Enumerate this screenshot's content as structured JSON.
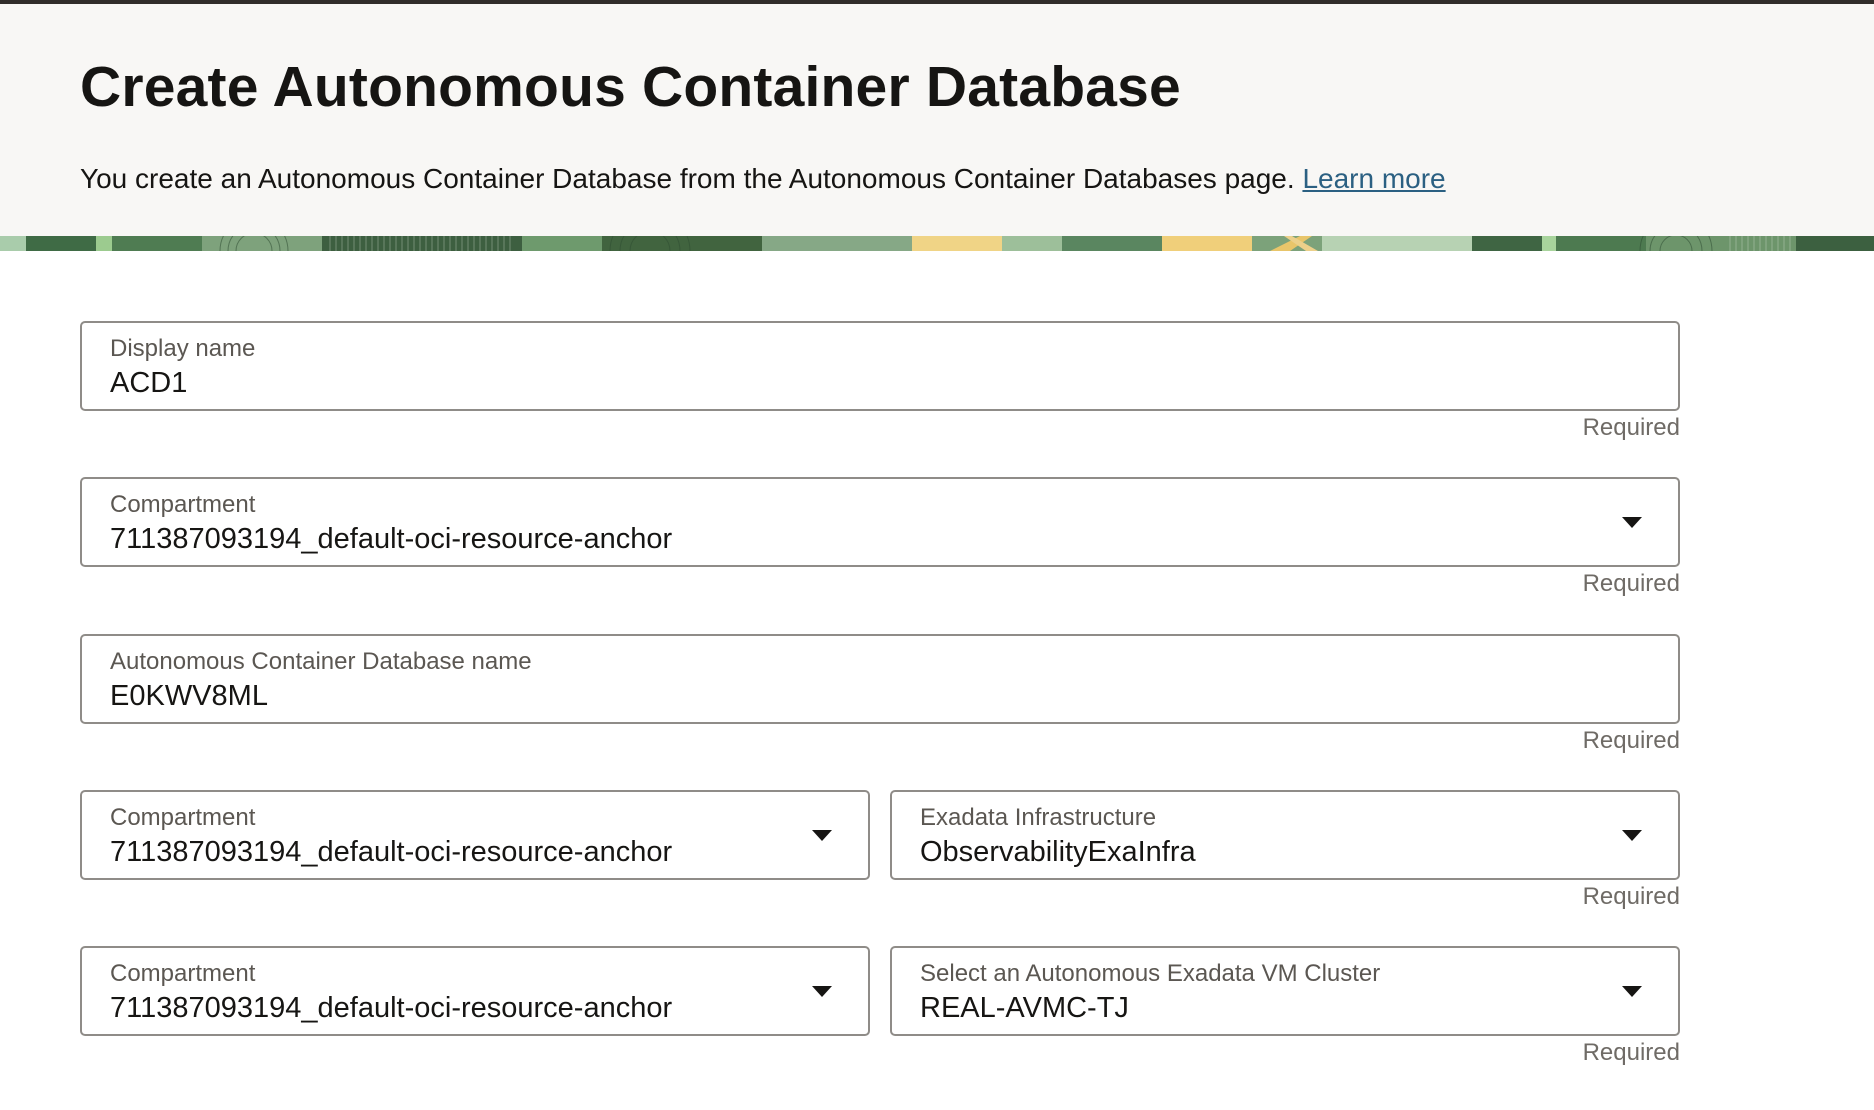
{
  "header": {
    "title": "Create Autonomous Container Database",
    "description": "You create an Autonomous Container Database from the Autonomous Container Databases page.",
    "learn_more": "Learn more"
  },
  "form": {
    "display_name": {
      "label": "Display name",
      "value": "ACD1",
      "hint": "Required"
    },
    "compartment": {
      "label": "Compartment",
      "value": "711387093194_default-oci-resource-anchor",
      "icon": "chevron-down-icon",
      "hint": "Required"
    },
    "acd_name": {
      "label": "Autonomous Container Database name",
      "value": "E0KWV8ML",
      "hint": "Required"
    },
    "infra_compartment": {
      "label": "Compartment",
      "value": "711387093194_default-oci-resource-anchor",
      "icon": "chevron-down-icon"
    },
    "exadata_infrastructure": {
      "label": "Exadata Infrastructure",
      "value": "ObservabilityExaInfra",
      "icon": "chevron-down-icon",
      "hint": "Required"
    },
    "cluster_compartment": {
      "label": "Compartment",
      "value": "711387093194_default-oci-resource-anchor",
      "icon": "chevron-down-icon"
    },
    "vm_cluster": {
      "label": "Select an Autonomous Exadata VM Cluster",
      "value": "REAL-AVMC-TJ",
      "icon": "chevron-down-icon",
      "hint": "Required"
    }
  }
}
